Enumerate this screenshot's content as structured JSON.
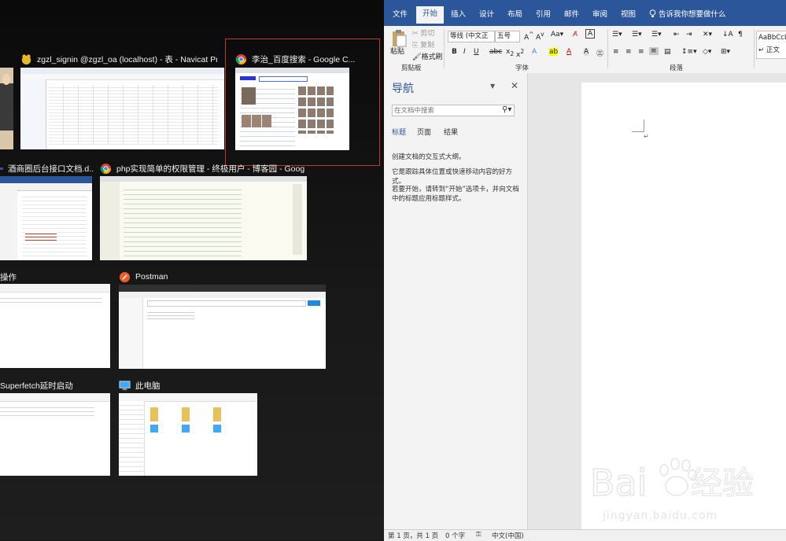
{
  "task_view": {
    "windows": [
      {
        "title": "zgzl_signin @zgzl_oa (localhost) - 表 - Navicat Premium",
        "icon": "navicat-icon"
      },
      {
        "title": "李治_百度搜索 - Google C...",
        "icon": "chrome-icon"
      },
      {
        "title": "酒商圈后台接口文档.d...",
        "icon": "word-icon"
      },
      {
        "title": "php实现简单的权限管理 - 终极用户 - 博客园 - Google Chr...",
        "icon": "chrome-icon"
      },
      {
        "title": "操作",
        "icon": "folder-icon"
      },
      {
        "title": "Postman",
        "icon": "postman-icon"
      },
      {
        "title": "Superfetch延时启动",
        "icon": "folder-icon"
      },
      {
        "title": "此电脑",
        "icon": "computer-icon"
      }
    ]
  },
  "word": {
    "tabs": [
      "文件",
      "开始",
      "插入",
      "设计",
      "布局",
      "引用",
      "邮件",
      "审阅",
      "视图"
    ],
    "active_tab": "开始",
    "tell_me": "告诉我你想要做什么",
    "clipboard": {
      "paste": "粘贴",
      "cut": "剪切",
      "copy": "复制",
      "format_painter": "格式刷",
      "group": "剪贴板"
    },
    "font": {
      "name": "等线 (中文正",
      "size": "五号",
      "group": "字体"
    },
    "paragraph": {
      "group": "段落"
    },
    "styles": {
      "preview": "AaBbCcL",
      "name": "↵ 正文"
    },
    "nav_pane": {
      "title": "导航",
      "search_placeholder": "在文档中搜索",
      "tabs": [
        "标题",
        "页面",
        "结果"
      ],
      "messages": [
        "创建文档的交互式大纲。",
        "它是跟踪具体位置或快速移动内容的好方式。",
        "若要开始，请转到“开始”选项卡，并向文档中的标题应用标题样式。"
      ]
    },
    "status": {
      "page": "第 1 页，共 1 页",
      "words": "0 个字",
      "language": "中文(中国)"
    }
  },
  "watermark": {
    "brand": "Bai",
    "brand_cn": "经验",
    "domain": "jingyan.baidu.com"
  }
}
